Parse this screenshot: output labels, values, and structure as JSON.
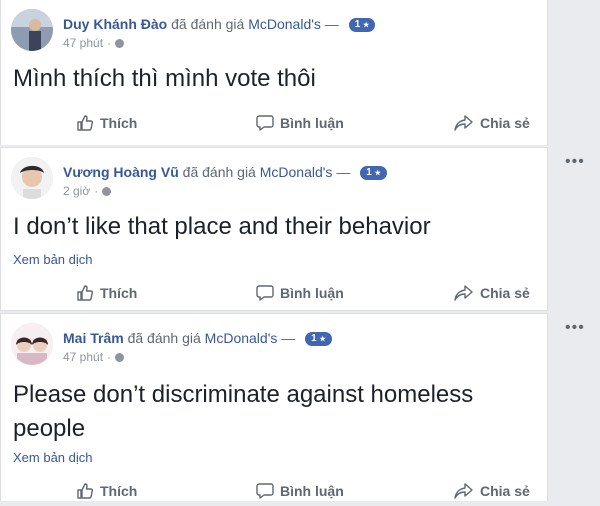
{
  "posts": [
    {
      "author": "Duy Khánh Đào",
      "action": "đã đánh giá",
      "page": "McDonald's",
      "dash": "—",
      "rating": "1",
      "time": "47 phút",
      "content": "Mình thích thì mình vote thôi",
      "translate": ""
    },
    {
      "author": "Vương Hoàng Vũ",
      "action": "đã đánh giá",
      "page": "McDonald's",
      "dash": "—",
      "rating": "1",
      "time": "2 giờ",
      "content": "I don’t like that place and their behavior",
      "translate": "Xem bản dịch"
    },
    {
      "author": "Mai Trâm",
      "action": "đã đánh giá",
      "page": "McDonald's",
      "dash": "—",
      "rating": "1",
      "time": "47 phút",
      "content": "Please don’t discriminate against homeless people",
      "translate": "Xem bản dịch"
    }
  ],
  "actions": {
    "like": "Thích",
    "comment": "Bình luận",
    "share": "Chia sẻ"
  },
  "more": "•••",
  "separator": "·",
  "icons": {
    "like": "thumbs-up-icon",
    "comment": "comment-bubble-icon",
    "share": "share-arrow-icon",
    "privacy": "globe-icon",
    "rating": "star-icon",
    "more": "more-options-icon"
  },
  "colors": {
    "link": "#385898",
    "badge": "#4267b2",
    "muted": "#90949c",
    "action": "#606770"
  }
}
